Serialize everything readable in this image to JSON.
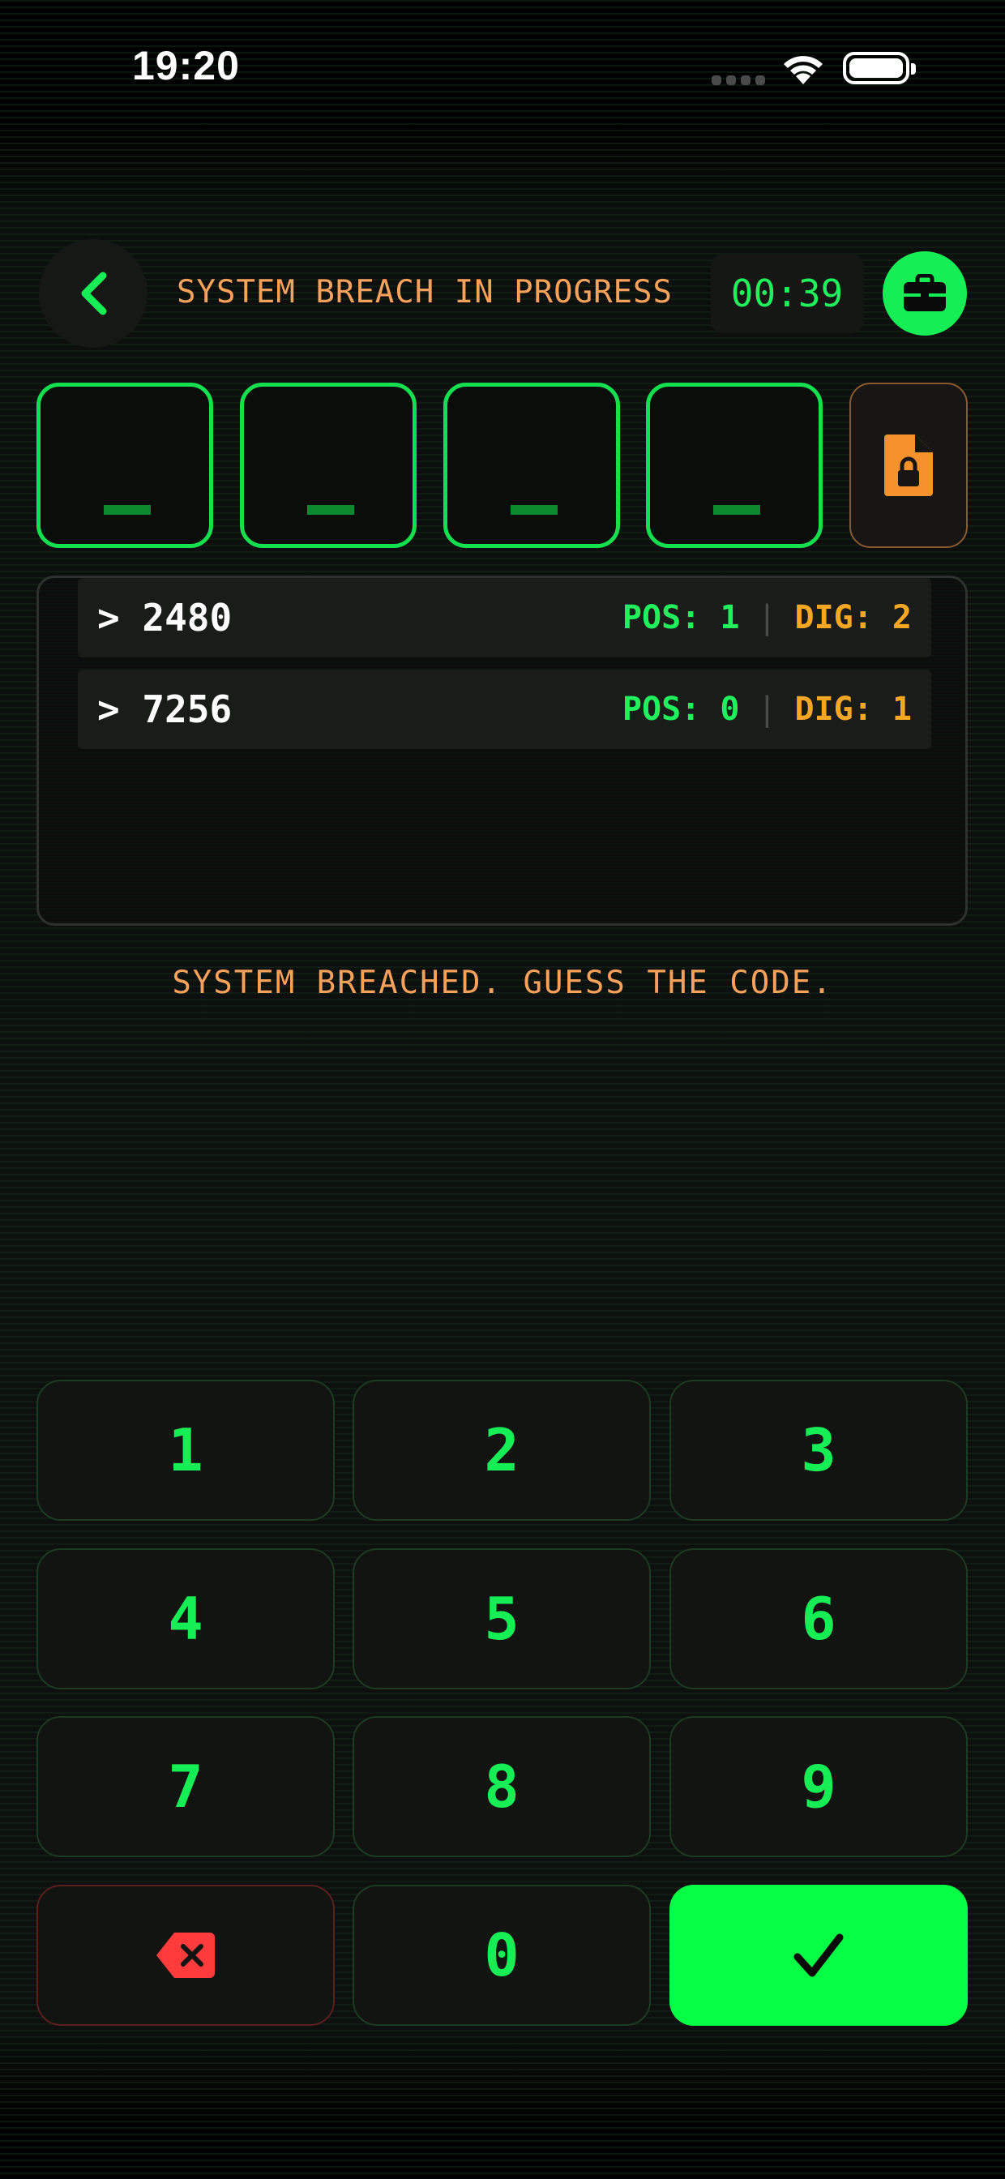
{
  "status_bar": {
    "time": "19:20"
  },
  "header": {
    "title": "SYSTEM BREACH IN PROGRESS",
    "timer": "00:39"
  },
  "slots": [
    "_",
    "_",
    "_",
    "_"
  ],
  "history": [
    {
      "code": "> 2480",
      "pos": "POS: 1",
      "separator": "|",
      "dig": "DIG: 2"
    },
    {
      "code": "> 7256",
      "pos": "POS: 0",
      "separator": "|",
      "dig": "DIG: 1"
    }
  ],
  "message": "SYSTEM BREACHED. GUESS THE CODE.",
  "keypad": {
    "keys": [
      "1",
      "2",
      "3",
      "4",
      "5",
      "6",
      "7",
      "8",
      "9"
    ],
    "zero": "0",
    "delete_icon": "backspace-icon",
    "submit_icon": "checkmark-icon"
  },
  "colors": {
    "accent_green": "#16ee56",
    "accent_orange": "#f7a15a",
    "dig_orange": "#f5a623",
    "delete_red": "#ff3b3b",
    "background": "#0d100e"
  }
}
